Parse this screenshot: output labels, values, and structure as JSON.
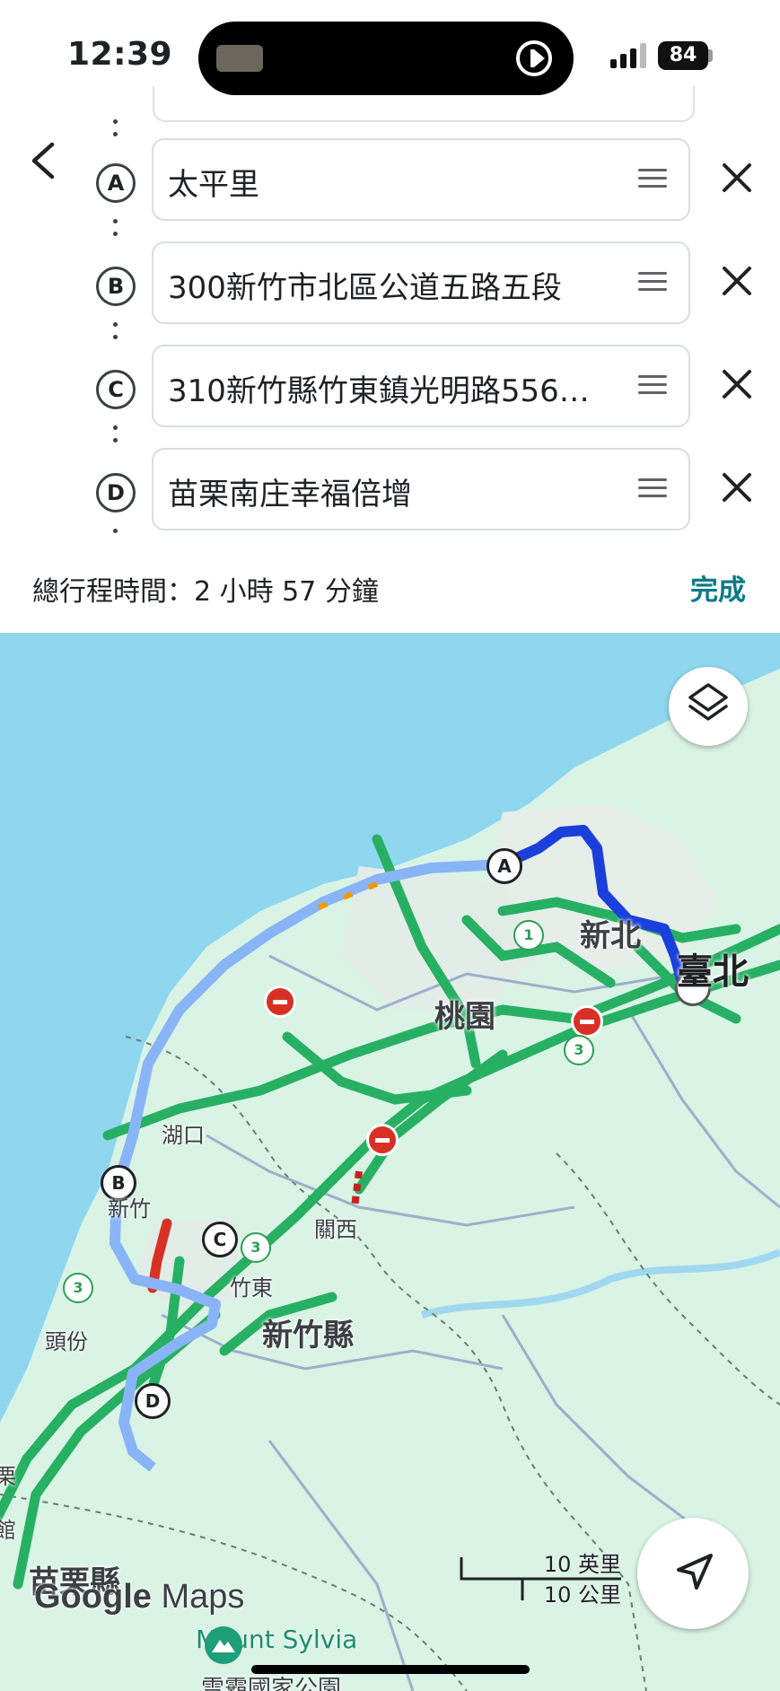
{
  "status_bar": {
    "time": "12:39",
    "battery": "84"
  },
  "route": {
    "stops": [
      {
        "marker": "A",
        "text": "太平里"
      },
      {
        "marker": "B",
        "text": "300新竹市北區公道五路五段"
      },
      {
        "marker": "C",
        "text": "310新竹縣竹東鎮光明路556巷..."
      },
      {
        "marker": "D",
        "text": "苗栗南庄幸福倍增"
      }
    ],
    "total_time": "總行程時間：2 小時 57 分鐘",
    "done_label": "完成"
  },
  "map": {
    "labels": {
      "taipei": "臺北",
      "new_taipei": "新北",
      "taoyuan": "桃園",
      "hukou": "湖口",
      "hsinchu": "新竹",
      "guanxi": "關西",
      "zhudong": "竹東",
      "hsinchu_county": "新竹縣",
      "toufen": "頭份",
      "miaoli_county": "苗栗縣",
      "mount_sylvia": "Mount Sylvia",
      "park_partial": "雪霸國家公園",
      "edge_1": "栗",
      "edge_2": "館"
    },
    "highway_shields": [
      "1",
      "3",
      "3",
      "3"
    ],
    "scale": {
      "miles": "10 英里",
      "km": "10 公里"
    },
    "logo": {
      "google": "Google",
      "maps": "Maps"
    },
    "colors": {
      "route_primary": "#1a3fdb",
      "route_alt": "#8ab4f8",
      "traffic_green": "#27b063",
      "water": "#8fd6ef",
      "land": "#d8f2e4"
    }
  }
}
